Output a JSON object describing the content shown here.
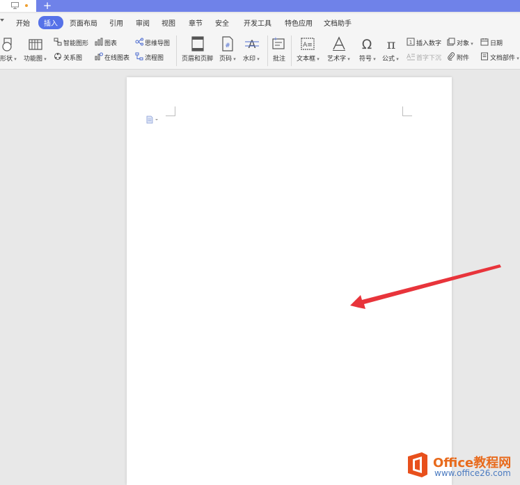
{
  "menu": {
    "items": [
      "开始",
      "插入",
      "页面布局",
      "引用",
      "审阅",
      "视图",
      "章节",
      "安全",
      "开发工具",
      "特色应用",
      "文档助手"
    ],
    "active": "插入"
  },
  "ribbon": {
    "shape": "形状",
    "function_chart": "功能图",
    "smart_art": "智能图形",
    "chart": "图表",
    "mind_map": "思维导图",
    "relation_chart": "关系图",
    "online_chart": "在线图表",
    "flow_chart": "流程图",
    "header_footer": "页眉和页脚",
    "page_number": "页码",
    "watermark": "水印",
    "comment": "批注",
    "text_box": "文本框",
    "word_art": "艺术字",
    "symbol": "符号",
    "formula": "公式",
    "insert_number": "插入数字",
    "object": "对象",
    "date": "日期",
    "drop_cap": "首字下沉",
    "attachment": "附件",
    "doc_parts": "文档部件"
  },
  "watermark_brand": {
    "title": "Office教程网",
    "url": "www.office26.com"
  },
  "colors": {
    "tab_strip": "#6f82e9",
    "active_tab": "#5672e8",
    "arrow": "#e8343b",
    "brand_orange": "#e86a1c"
  }
}
